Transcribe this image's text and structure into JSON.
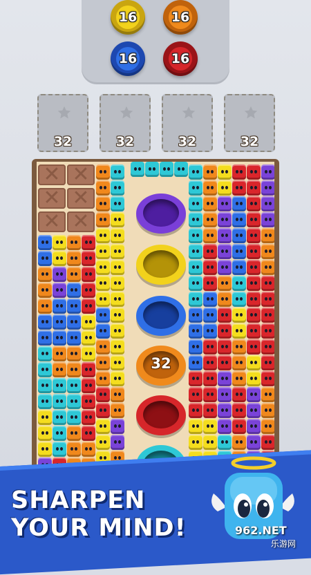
{
  "tray": {
    "coins": [
      {
        "value": "16",
        "color": "#f2d21c",
        "ring": "#c9a510"
      },
      {
        "value": "16",
        "color": "#f08a1c",
        "ring": "#c0630c"
      },
      {
        "value": "16",
        "color": "#2f6fe6",
        "ring": "#1d48b0"
      },
      {
        "value": "16",
        "color": "#d6262a",
        "ring": "#9a1418"
      }
    ]
  },
  "slots": [
    {
      "count": "32"
    },
    {
      "count": "32"
    },
    {
      "count": "32"
    },
    {
      "count": "32"
    }
  ],
  "board": {
    "holes": [
      {
        "color": "#7a3fd8",
        "inner": "#4e1ea0",
        "label": ""
      },
      {
        "color": "#f2d21c",
        "inner": "#b49308",
        "label": ""
      },
      {
        "color": "#2f6fe6",
        "inner": "#173f9e",
        "label": ""
      },
      {
        "color": "#f08a1c",
        "inner": "#c0630c",
        "label": "32"
      },
      {
        "color": "#d6262a",
        "inner": "#8e1014",
        "label": ""
      },
      {
        "color": "#2ec8d6",
        "inner": "#138a96",
        "label": ""
      }
    ],
    "palette": {
      "R": "#d9262b",
      "O": "#f0881c",
      "Y": "#f4dd1e",
      "B": "#2f6fe6",
      "P": "#7a43d8",
      "C": "#2ec8d6"
    }
  },
  "banner": {
    "line1": "SHARPEN",
    "line2": "YOUR MIND!"
  },
  "watermark": {
    "brand": "962.NET",
    "sub": "乐游网"
  }
}
